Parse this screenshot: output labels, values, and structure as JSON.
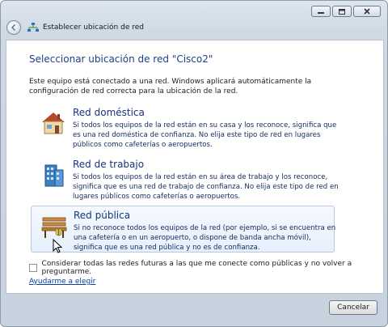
{
  "window": {
    "title": "Establecer ubicación de red",
    "controls": [
      "minimize-icon",
      "maximize-icon",
      "close-icon"
    ]
  },
  "content": {
    "heading": "Seleccionar ubicación de red \"Cisco2\"",
    "intro": "Este equipo está conectado a una red. Windows aplicará automáticamente la configuración de red correcta para la ubicación de la red.",
    "options": [
      {
        "icon": "house-icon",
        "title": "Red doméstica",
        "description": "Si todos los equipos de la red están en su casa y los reconoce, significa que es una red doméstica de confianza. No elija este tipo de red en lugares públicos como cafeterías o aeropuertos."
      },
      {
        "icon": "office-building-icon",
        "title": "Red de trabajo",
        "description": "Si todos los equipos de la red están en su área de trabajo y los reconoce, significa que es una red de trabajo de confianza. No elija este tipo de red en lugares públicos como cafeterías o aeropuertos."
      },
      {
        "icon": "park-bench-icon",
        "title": "Red pública",
        "description": "Si no reconoce todos los equipos de la red (por ejemplo, si se encuentra en una cafetería o en un aeropuerto, o dispone de banda ancha móvil), significa que es una red pública y no es de confianza."
      }
    ],
    "checkbox_label": "Considerar todas las redes futuras a las que me conecte como públicas y no volver a preguntarme.",
    "checkbox_checked": false,
    "help_link": "Ayudarme a elegir"
  },
  "footer": {
    "cancel_label": "Cancelar"
  },
  "colors": {
    "heading": "#1e3f86",
    "link": "#0b3f9e",
    "hover_border": "#b4c9e6"
  }
}
